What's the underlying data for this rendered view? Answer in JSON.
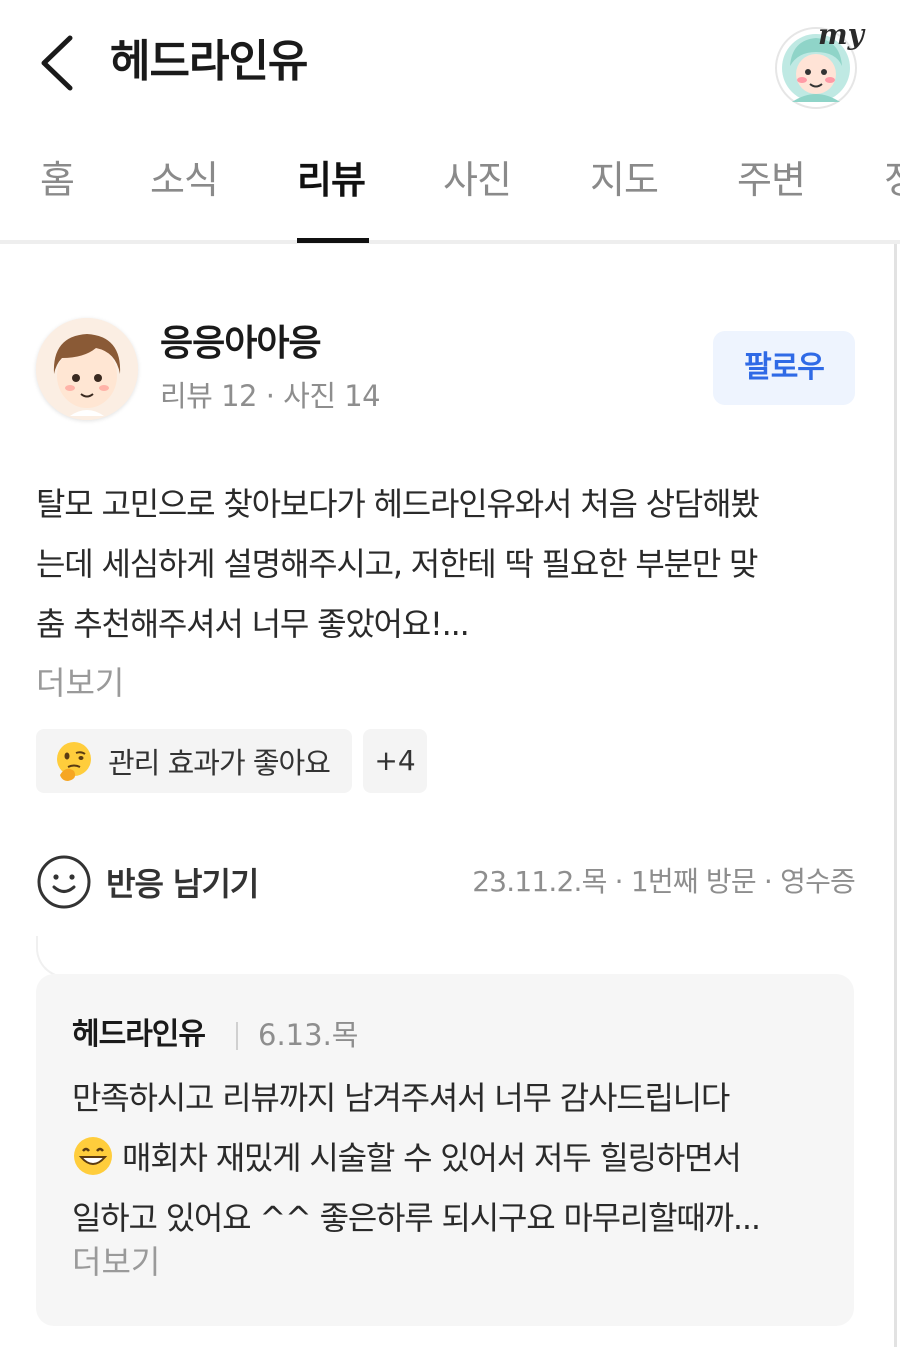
{
  "header": {
    "title": "헤드라인유",
    "my_label": "my"
  },
  "tabs": [
    {
      "label": "홈"
    },
    {
      "label": "소식"
    },
    {
      "label": "리뷰",
      "active": true
    },
    {
      "label": "사진"
    },
    {
      "label": "지도"
    },
    {
      "label": "주변"
    },
    {
      "label": "정"
    }
  ],
  "review": {
    "author_name": "응응아아응",
    "author_meta": "리뷰 12 · 사진 14",
    "follow_label": "팔로우",
    "body_lines": [
      "탈모 고민으로 찾아보다가 헤드라인유와서 처음 상담해봤",
      "는데 세심하게 설명해주시고, 저한테 딱 필요한 부분만 맞",
      "춤 추천해주셔서 너무 좋았어요!..."
    ],
    "more_label": "더보기",
    "tag_label": "관리 효과가 좋아요",
    "tag_more": "+4",
    "react_label": "반응 남기기",
    "visit_meta": "23.11.2.목 · 1번째 방문 · 영수증"
  },
  "reply": {
    "owner_name": "헤드라인유",
    "date": "6.13.목",
    "line1": "만족하시고 리뷰까지 남겨주셔서 너무 감사드립니다",
    "line2": "매회차 재밌게 시술할 수 있어서 저두 힐링하면서",
    "line3": "일하고 있어요 ^^ 좋은하루 되시구요 마무리할때까...",
    "more_label": "더보기"
  },
  "colors": {
    "accent_blue": "#2f6ae6",
    "follow_bg": "#eef4fe",
    "muted_text": "#8e8e8e"
  },
  "icons": {
    "back": "chevron-left-icon",
    "my": "my-profile-avatar-icon",
    "tag": "thinking-face-emoji-icon",
    "react": "smiley-icon",
    "reply_emoji": "grinning-face-emoji-icon"
  }
}
